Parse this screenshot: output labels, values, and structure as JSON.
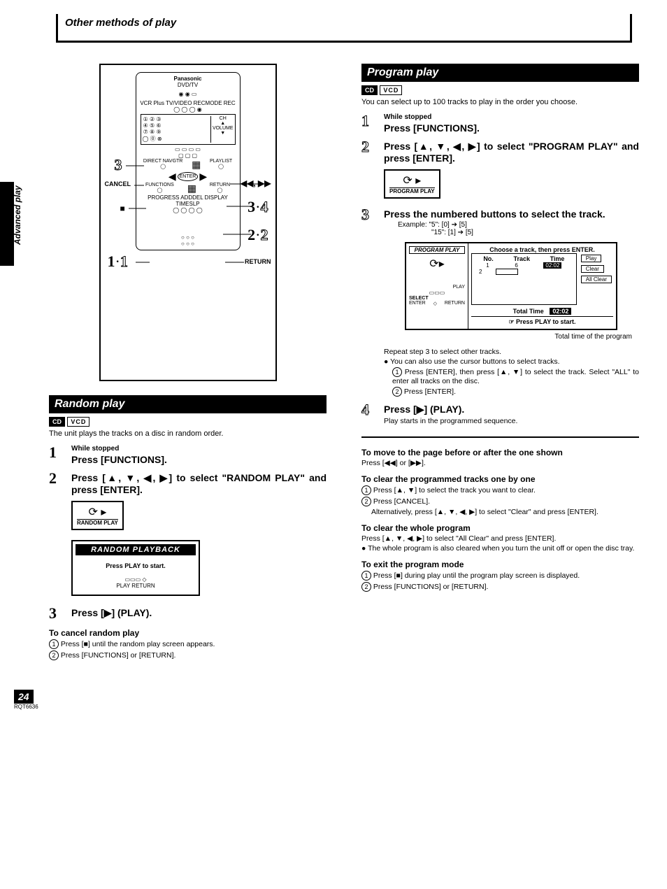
{
  "header": "Other methods of play",
  "side_label": "Advanced play",
  "remote": {
    "brand": "Panasonic",
    "subbrand": "DVD/TV",
    "callout_3": "3",
    "callout_cancel": "CANCEL",
    "callout_rewff": "◀◀, ▶▶",
    "callout_34": "3·4",
    "callout_22": "2·2",
    "callout_11": "1·1",
    "callout_return": "RETURN",
    "callout_stop": "■"
  },
  "random": {
    "header": "Random play",
    "badge_cd": "CD",
    "badge_vcd": "VCD",
    "intro": "The unit plays the tracks on a disc in random order.",
    "s1_num": "1",
    "s1_small": "While stopped",
    "s1_title": "Press [FUNCTIONS].",
    "s2_num": "2",
    "s2_title": "Press [▲, ▼, ◀, ▶] to select \"RANDOM PLAY\" and press [ENTER].",
    "icon1_label": "RANDOM PLAY",
    "rpb_header": "RANDOM PLAYBACK",
    "rpb_text": "Press PLAY to start.",
    "rpb_labels": "PLAY   RETURN",
    "s3_num": "3",
    "s3_title": "Press [▶] (PLAY).",
    "cancel_heading": "To cancel random play",
    "cancel_1": "Press [■] until the random play screen appears.",
    "cancel_2": "Press [FUNCTIONS] or [RETURN]."
  },
  "program": {
    "header": "Program play",
    "badge_cd": "CD",
    "badge_vcd": "VCD",
    "intro": "You can select up to 100 tracks to play in the order you choose.",
    "s1_num": "1",
    "s1_small": "While stopped",
    "s1_title": "Press [FUNCTIONS].",
    "s2_num": "2",
    "s2_title": "Press [▲, ▼, ◀, ▶] to select \"PROGRAM PLAY\" and press [ENTER].",
    "icon2_label": "PROGRAM PLAY",
    "s3_num": "3",
    "s3_title": "Press the numbered buttons to select the track.",
    "s3_example1": "Example: \"5\": [0] ➔ [5]",
    "s3_example2": "\"15\": [1] ➔ [5]",
    "screen": {
      "title": "PROGRAM PLAY",
      "choose": "Choose a track, then press ENTER.",
      "col_no": "No.",
      "col_track": "Track",
      "col_time": "Time",
      "row1_no": "1",
      "row1_track": "6",
      "row1_time": "02:02",
      "row2_no": "2",
      "btn_play": "Play",
      "btn_clear": "Clear",
      "btn_allclear": "All Clear",
      "left_play": "PLAY",
      "left_select": "SELECT",
      "left_enter": "ENTER",
      "left_return": "RETURN",
      "total_label": "Total Time",
      "total_val": "02:02",
      "hint": "☞ Press PLAY to start."
    },
    "screen_caption": "Total time of the program",
    "repeat": "Repeat step 3 to select other tracks.",
    "cursor_note": "You can also use the cursor buttons to select tracks.",
    "cursor_1": "Press [ENTER], then press [▲, ▼] to select the track. Select \"ALL\" to enter all tracks on the disc.",
    "cursor_2": "Press [ENTER].",
    "s4_num": "4",
    "s4_title": "Press [▶] (PLAY).",
    "s4_sub": "Play starts in the programmed sequence.",
    "move_heading": "To move to the page before or after the one shown",
    "move_text": "Press [◀◀] or [▶▶].",
    "clear1_heading": "To clear the programmed tracks one by one",
    "clear1_1": "Press [▲, ▼] to select the track you want to clear.",
    "clear1_2": "Press [CANCEL].",
    "clear1_alt": "Alternatively, press [▲, ▼, ◀, ▶] to select \"Clear\" and press [ENTER].",
    "clearall_heading": "To clear the whole program",
    "clearall_text": "Press [▲, ▼, ◀, ▶] to select \"All Clear\" and press [ENTER].",
    "clearall_note": "The whole program is also cleared when you turn the unit off or open the disc tray.",
    "exit_heading": "To exit the program mode",
    "exit_1": "Press [■] during play until the program play screen is displayed.",
    "exit_2": "Press [FUNCTIONS] or [RETURN]."
  },
  "page_number": "24",
  "doc_code": "RQT6636"
}
